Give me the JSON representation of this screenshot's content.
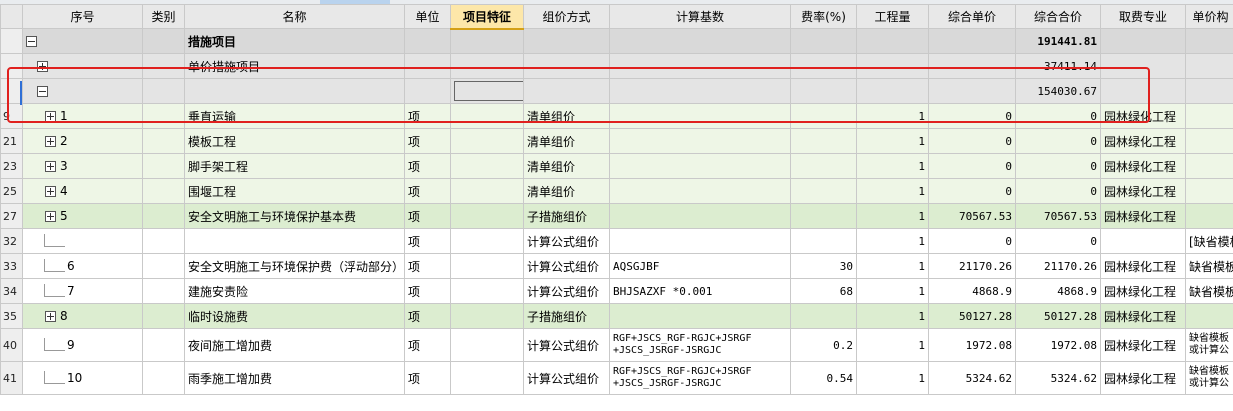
{
  "headers": {
    "seq": "序号",
    "category": "类别",
    "name": "名称",
    "unit": "单位",
    "feature": "项目特征",
    "group_method": "组价方式",
    "calc_base": "计算基数",
    "rate": "费率(%)",
    "quantity": "工程量",
    "unit_price": "综合单价",
    "total_price": "综合合价",
    "fee_spec": "取费专业",
    "unit_comp": "单价构"
  },
  "rows": [
    {
      "rn": "",
      "seq": "",
      "name": "措施项目",
      "unit": "",
      "group": "",
      "base": "",
      "rate": "",
      "qty": "",
      "uprice": "",
      "total": "191441.81",
      "fee": "",
      "comp": ""
    },
    {
      "rn": "",
      "seq": "",
      "name": "单价措施项目",
      "unit": "",
      "group": "",
      "base": "",
      "rate": "",
      "qty": "",
      "uprice": "",
      "total": "37411.14",
      "fee": "",
      "comp": ""
    },
    {
      "rn": "",
      "seq": "",
      "name": "",
      "unit": "",
      "group": "",
      "base": "",
      "rate": "",
      "qty": "",
      "uprice": "",
      "total": "154030.67",
      "fee": "",
      "comp": ""
    },
    {
      "rn": "9",
      "seq": "1",
      "name": "垂直运输",
      "unit": "项",
      "group": "清单组价",
      "base": "",
      "rate": "",
      "qty": "1",
      "uprice": "0",
      "total": "0",
      "fee": "园林绿化工程",
      "comp": ""
    },
    {
      "rn": "21",
      "seq": "2",
      "name": "模板工程",
      "unit": "项",
      "group": "清单组价",
      "base": "",
      "rate": "",
      "qty": "1",
      "uprice": "0",
      "total": "0",
      "fee": "园林绿化工程",
      "comp": ""
    },
    {
      "rn": "23",
      "seq": "3",
      "name": "脚手架工程",
      "unit": "项",
      "group": "清单组价",
      "base": "",
      "rate": "",
      "qty": "1",
      "uprice": "0",
      "total": "0",
      "fee": "园林绿化工程",
      "comp": ""
    },
    {
      "rn": "25",
      "seq": "4",
      "name": "围堰工程",
      "unit": "项",
      "group": "清单组价",
      "base": "",
      "rate": "",
      "qty": "1",
      "uprice": "0",
      "total": "0",
      "fee": "园林绿化工程",
      "comp": ""
    },
    {
      "rn": "27",
      "seq": "5",
      "name": "安全文明施工与环境保护基本费",
      "unit": "项",
      "group": "子措施组价",
      "base": "",
      "rate": "",
      "qty": "1",
      "uprice": "70567.53",
      "total": "70567.53",
      "fee": "园林绿化工程",
      "comp": ""
    },
    {
      "rn": "32",
      "seq": "",
      "name": "",
      "unit": "项",
      "group": "计算公式组价",
      "base": "",
      "rate": "",
      "qty": "1",
      "uprice": "0",
      "total": "0",
      "fee": "",
      "comp": "[缺省模板"
    },
    {
      "rn": "33",
      "seq": "6",
      "name": "安全文明施工与环境保护费（浮动部分）",
      "unit": "项",
      "group": "计算公式组价",
      "base": "AQSGJBF",
      "rate": "30",
      "qty": "1",
      "uprice": "21170.26",
      "total": "21170.26",
      "fee": "园林绿化工程",
      "comp": "缺省模板"
    },
    {
      "rn": "34",
      "seq": "7",
      "name": "建施安责险",
      "unit": "项",
      "group": "计算公式组价",
      "base": "BHJSAZXF *0.001",
      "rate": "68",
      "qty": "1",
      "uprice": "4868.9",
      "total": "4868.9",
      "fee": "园林绿化工程",
      "comp": "缺省模板"
    },
    {
      "rn": "35",
      "seq": "8",
      "name": "临时设施费",
      "unit": "项",
      "group": "子措施组价",
      "base": "",
      "rate": "",
      "qty": "1",
      "uprice": "50127.28",
      "total": "50127.28",
      "fee": "园林绿化工程",
      "comp": ""
    },
    {
      "rn": "40",
      "seq": "9",
      "name": "夜间施工增加费",
      "unit": "项",
      "group": "计算公式组价",
      "base": "RGF+JSCS_RGF-RGJC+JSRGF",
      "base2": "+JSCS_JSRGF-JSRGJC",
      "rate": "0.2",
      "qty": "1",
      "uprice": "1972.08",
      "total": "1972.08",
      "fee": "园林绿化工程",
      "comp": "缺省模板",
      "comp2": "或计算公"
    },
    {
      "rn": "41",
      "seq": "10",
      "name": "雨季施工增加费",
      "unit": "项",
      "group": "计算公式组价",
      "base": "RGF+JSCS_RGF-RGJC+JSRGF",
      "base2": "+JSCS_JSRGF-JSRGJC",
      "rate": "0.54",
      "qty": "1",
      "uprice": "5324.62",
      "total": "5324.62",
      "fee": "园林绿化工程",
      "comp": "缺省模板",
      "comp2": "或计算公"
    }
  ]
}
